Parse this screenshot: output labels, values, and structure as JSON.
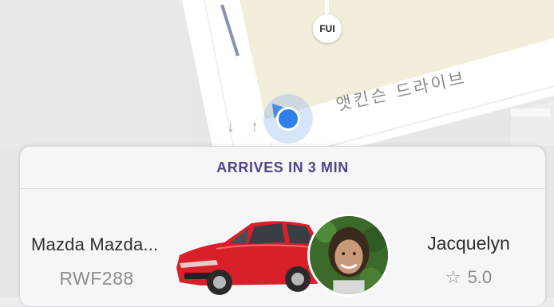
{
  "map": {
    "road_label": "앳킨슨 드라이브",
    "poi_label": "FUI",
    "colors": {
      "building": "#f4efdc",
      "road": "#ffffff",
      "land": "#e6e6ea",
      "location": "#2f80ed"
    }
  },
  "ride_card": {
    "eta_text": "ARRIVES IN 3 MIN",
    "vehicle": {
      "name": "Mazda Mazda...",
      "plate": "RWF288",
      "color_name": "red",
      "image_icon": "car-image"
    },
    "driver": {
      "name": "Jacquelyn",
      "rating_icon": "star-icon",
      "rating_glyph": "☆",
      "rating": "5.0",
      "photo_icon": "driver-photo"
    },
    "accent_color": "#53438a"
  }
}
